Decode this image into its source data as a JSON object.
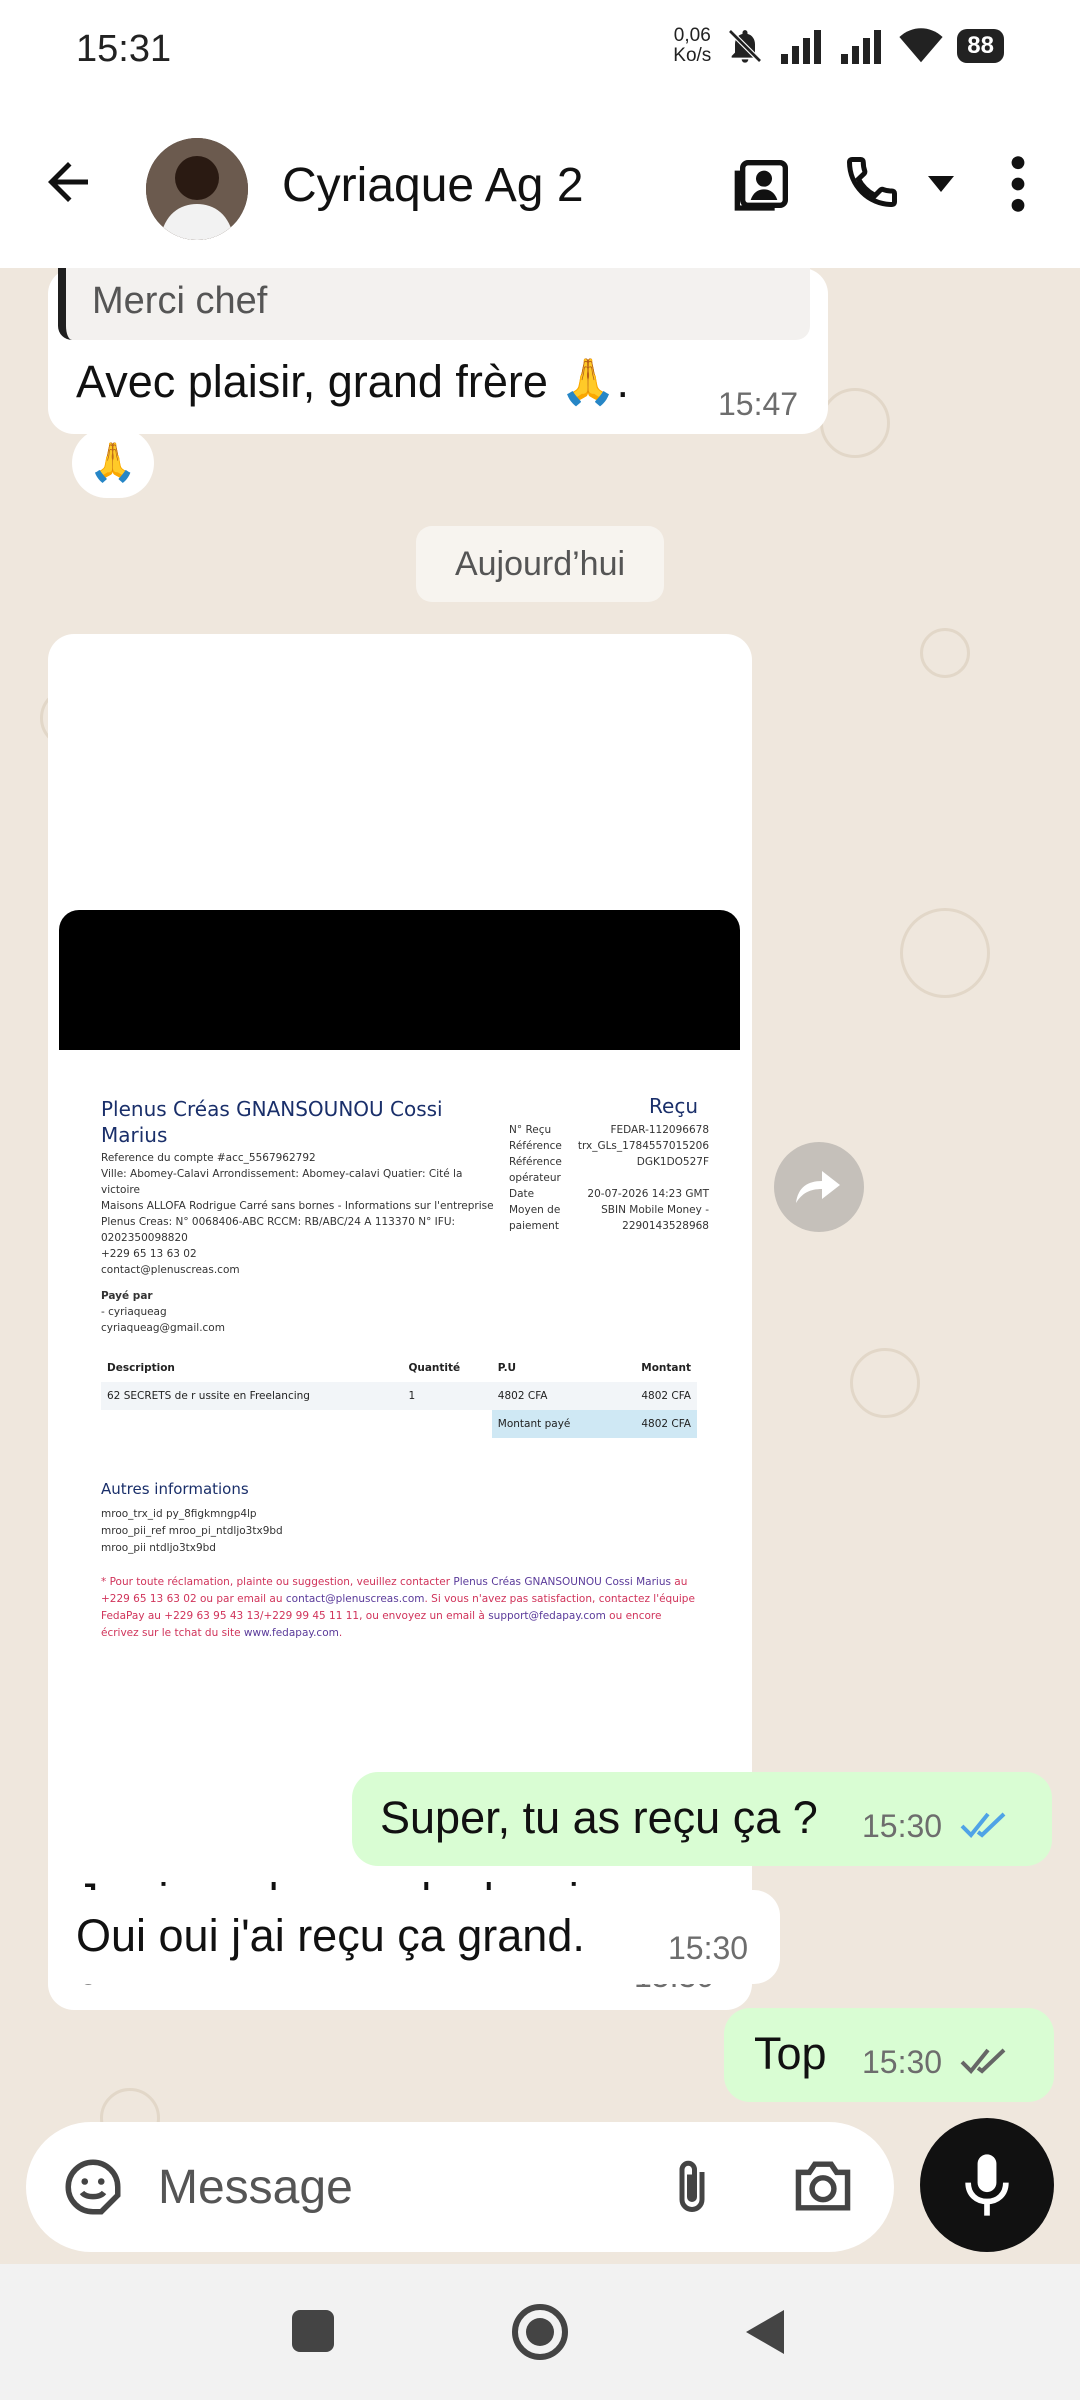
{
  "status_bar": {
    "time": "15:31",
    "speed_value": "0,06",
    "speed_unit": "Ko/s",
    "battery": "88"
  },
  "header": {
    "contact_name": "Cyriaque Ag 2"
  },
  "messages": {
    "m1": {
      "quote": "Merci chef",
      "text": "Avec plaisir, grand frère 🙏.",
      "time": "15:47",
      "reaction": "🙏"
    },
    "date_chip": "Aujourd’hui",
    "m2": {
      "caption_line1": "Je viens de prendre le mien",
      "caption_line2": "grand",
      "time": "15:30"
    },
    "m3": {
      "text": "Super, tu as reçu ça ?",
      "time": "15:30"
    },
    "m4": {
      "text": "Oui oui j'ai reçu ça grand.",
      "time": "15:30"
    },
    "m5": {
      "text": "Top",
      "time": "15:30"
    }
  },
  "receipt": {
    "title": "Plenus Créas GNANSOUNOU Cossi Marius",
    "heading": "Reçu",
    "info_lines": [
      "Reference du compte #acc_5567962792",
      "Ville: Abomey-Calavi Arrondissement: Abomey-calavi Quatier: Cité la victoire",
      "Maisons ALLOFA Rodrigue Carré sans bornes - Informations sur l'entreprise",
      "Plenus Creas: N° 0068406-ABC RCCM: RB/ABC/24 A 113370 N° IFU:",
      "0202350098820",
      "+229 65 13 63 02",
      "contact@plenuscreas.com"
    ],
    "meta": [
      {
        "k": "N° Reçu",
        "v": "FEDAR-112096678"
      },
      {
        "k": "Référence",
        "v": "trx_GLs_1784557015206"
      },
      {
        "k": "Référence",
        "v": "DGK1DO527F"
      },
      {
        "k": "opérateur",
        "v": ""
      },
      {
        "k": "Date",
        "v": "20-07-2026 14:23 GMT"
      },
      {
        "k": "Moyen de",
        "v": "SBIN Mobile Money -"
      },
      {
        "k": "paiement",
        "v": "2290143528968"
      }
    ],
    "payer_label": "Payé par",
    "payer_lines": [
      "- cyriaqueag",
      "cyriaqueag@gmail.com"
    ],
    "table_headers": [
      "Description",
      "Quantité",
      "P.U",
      "Montant"
    ],
    "table_row": [
      "62 SECRETS de r ussite en Freelancing",
      "1",
      "4802 CFA",
      "4802 CFA"
    ],
    "paid_label": "Montant payé",
    "paid_value": "4802 CFA",
    "other_title": "Autres informations",
    "kv_lines": [
      "mroo_trx_id   py_8figkmngp4lp",
      "mroo_pii_ref  mroo_pi_ntdljo3tx9bd",
      "mroo_pii      ntdljo3tx9bd"
    ],
    "note_a": "* Pour toute réclamation, plainte ou suggestion, veuillez contacter ",
    "note_name": "Plenus Créas GNANSOUNOU Cossi Marius",
    "note_b": " au +229 65 13 63 02 ou par email au ",
    "note_email": "contact@plenuscreas.com",
    "note_c": ". Si vous n'avez pas satisfaction, contactez l'équipe FedaPay au +229 63 95 43 13/+229 99 45 11 11, ou envoyez un email à ",
    "note_email2": "support@fedapay.com",
    "note_d": " ou encore écrivez sur le tchat du site ",
    "note_site": "www.fedapay.com",
    "note_e": "."
  },
  "composer": {
    "placeholder": "Message"
  },
  "colors": {
    "outgoing_bubble": "#d9fdd3",
    "incoming_bubble": "#ffffff",
    "chat_bg": "#efe7dd",
    "read_tick": "#4fa3e6"
  }
}
